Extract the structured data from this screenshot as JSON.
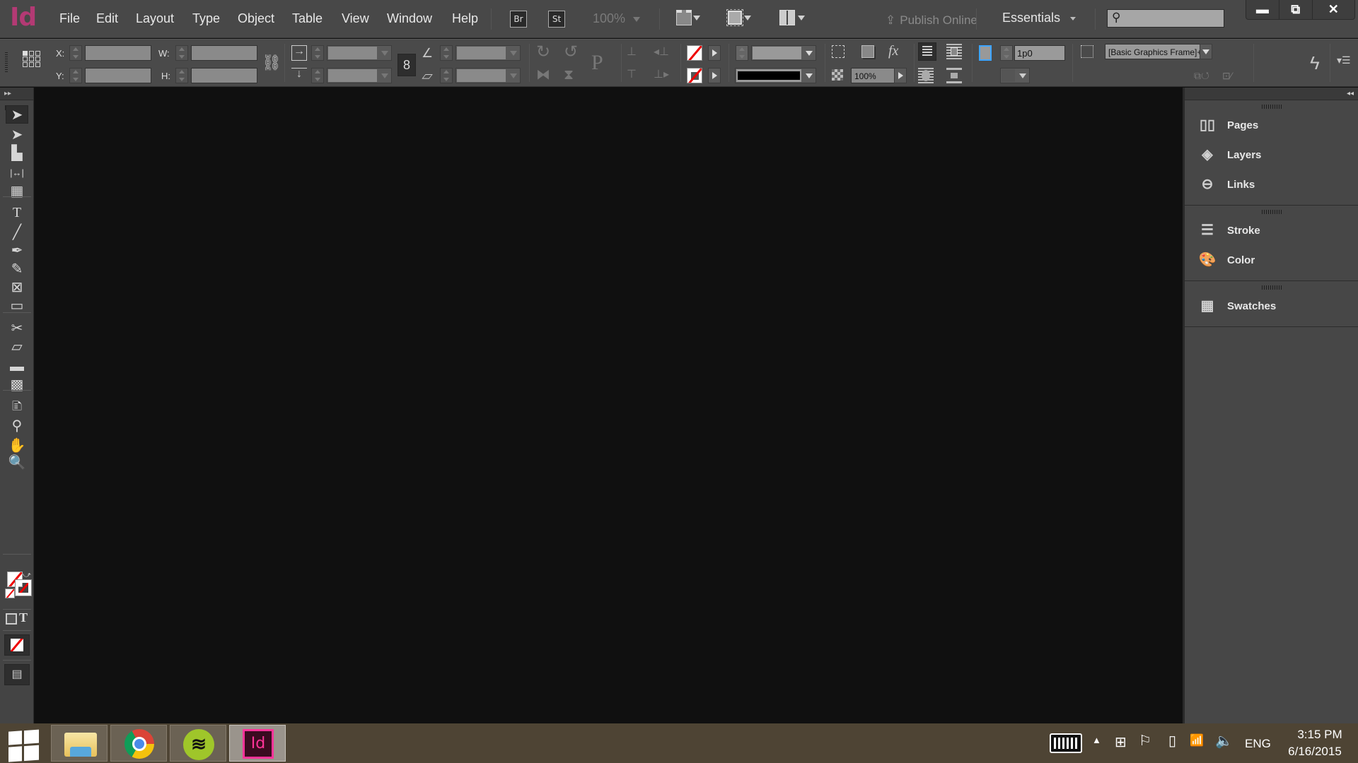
{
  "app": {
    "logo": "Id",
    "menu": [
      "File",
      "Edit",
      "Layout",
      "Type",
      "Object",
      "Table",
      "View",
      "Window",
      "Help"
    ],
    "bridge_label": "Br",
    "stock_label": "St",
    "zoom_level": "100%",
    "publish_label": "Publish Online",
    "workspace": "Essentials",
    "search_placeholder": "",
    "window_controls": {
      "minimize": "minimize",
      "restore": "restore",
      "close": "close"
    }
  },
  "control_panel": {
    "x_label": "X:",
    "y_label": "Y:",
    "w_label": "W:",
    "h_label": "H:",
    "x_value": "",
    "y_value": "",
    "w_value": "",
    "h_value": "",
    "opacity": "100%",
    "stroke_weight": "1p0",
    "object_style": "[Basic Graphics Frame]+",
    "fill_color": "none",
    "stroke_color": "none",
    "stroke_type": "solid"
  },
  "tools": [
    {
      "name": "selection-tool",
      "glyph": "➤",
      "selected": true
    },
    {
      "name": "direct-selection-tool",
      "glyph": "➤"
    },
    {
      "name": "page-tool",
      "glyph": "▙"
    },
    {
      "name": "gap-tool",
      "glyph": "|↔|"
    },
    {
      "name": "content-collector-tool",
      "glyph": "▦"
    },
    {
      "name": "type-tool",
      "glyph": "T"
    },
    {
      "name": "line-tool",
      "glyph": "╱"
    },
    {
      "name": "pen-tool",
      "glyph": "✒"
    },
    {
      "name": "pencil-tool",
      "glyph": "✎"
    },
    {
      "name": "rectangle-frame-tool",
      "glyph": "⊠"
    },
    {
      "name": "rectangle-tool",
      "glyph": "▭"
    },
    {
      "name": "scissors-tool",
      "glyph": "✂"
    },
    {
      "name": "free-transform-tool",
      "glyph": "▱"
    },
    {
      "name": "gradient-swatch-tool",
      "glyph": "▬"
    },
    {
      "name": "gradient-feather-tool",
      "glyph": "▩"
    },
    {
      "name": "note-tool",
      "glyph": "🗈"
    },
    {
      "name": "eyedropper-tool",
      "glyph": "⚲"
    },
    {
      "name": "hand-tool",
      "glyph": "✋"
    },
    {
      "name": "zoom-tool",
      "glyph": "🔍"
    }
  ],
  "panels": {
    "groups": [
      [
        {
          "label": "Pages",
          "icon": "pages-icon",
          "glyph": "▯▯"
        },
        {
          "label": "Layers",
          "icon": "layers-icon",
          "glyph": "◈"
        },
        {
          "label": "Links",
          "icon": "links-icon",
          "glyph": "⊖"
        }
      ],
      [
        {
          "label": "Stroke",
          "icon": "stroke-icon",
          "glyph": "☰"
        },
        {
          "label": "Color",
          "icon": "color-icon",
          "glyph": "🎨"
        }
      ],
      [
        {
          "label": "Swatches",
          "icon": "swatches-icon",
          "glyph": "▦"
        }
      ]
    ]
  },
  "taskbar": {
    "apps": [
      {
        "name": "file-explorer",
        "active": false
      },
      {
        "name": "chrome",
        "active": false
      },
      {
        "name": "spotify",
        "active": false
      },
      {
        "name": "indesign",
        "label": "Id",
        "active": true
      }
    ],
    "language": "ENG",
    "time": "3:15 PM",
    "date": "6/16/2015"
  },
  "colors": {
    "indesign_brand": "#ff3399",
    "logo_pink": "#b33a74",
    "canvas": "#101010",
    "chrome_bg": "#484848",
    "taskbar": "#4e4434"
  }
}
